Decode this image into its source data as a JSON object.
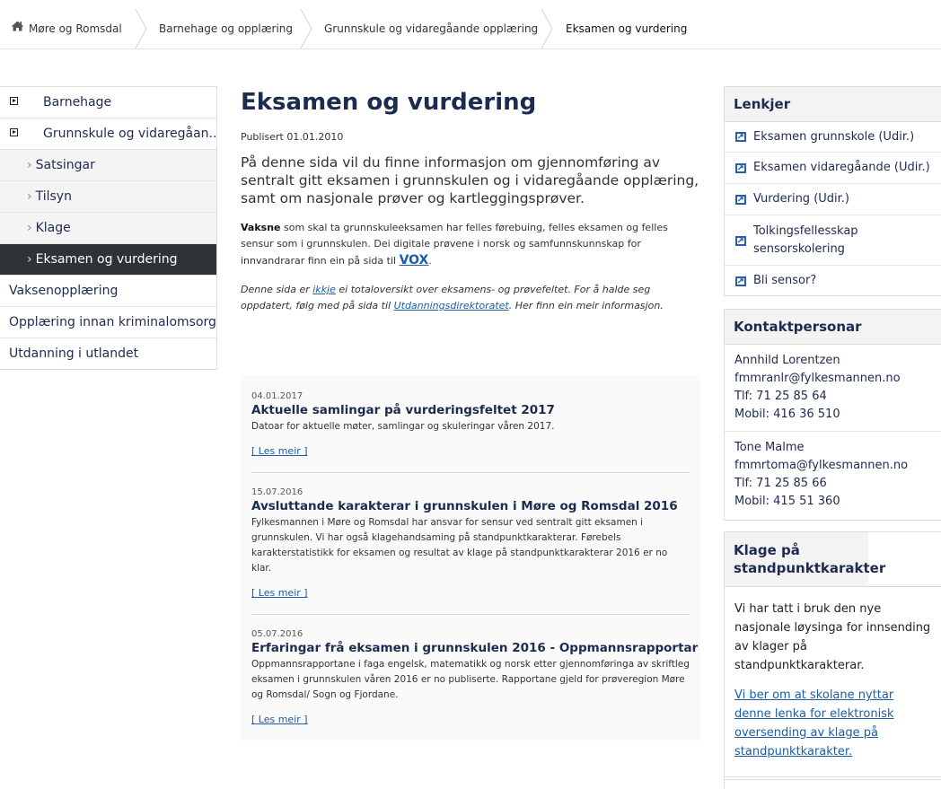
{
  "breadcrumb": {
    "items": [
      "Møre og Romsdal",
      "Barnehage og opplæring",
      "Grunnskule og vidaregåande opplæring",
      "Eksamen og vurdering"
    ]
  },
  "sidebar": {
    "items": [
      {
        "label": "Barnehage"
      },
      {
        "label": "Grunnskule og vidaregåan..."
      },
      {
        "label": "Satsingar"
      },
      {
        "label": "Tilsyn"
      },
      {
        "label": "Klage"
      },
      {
        "label": "Eksamen og vurdering"
      },
      {
        "label": "Vaksenopplæring"
      },
      {
        "label": "Opplæring innan kriminalomsorga"
      },
      {
        "label": "Utdanning i utlandet"
      }
    ]
  },
  "main": {
    "title": "Eksamen og vurdering",
    "published": "Publisert 01.01.2010",
    "ingress": "På denne sida vil du finne informasjon om gjennomføring av sentralt gitt eksamen i grunnskulen og i vidaregåande opplæring, samt om nasjonale prøver og kartleggingsprøver.",
    "para1_bold": "Vaksne",
    "para1_text": " som skal ta grunnskuleeksamen har felles førebuing, felles eksamen og felles sensur som i grunnskulen. Dei digitale prøvene i norsk og samfunnskunnskap for innvandrarar finn ein på sida til ",
    "para1_link": "VOX",
    "para1_end": ".",
    "para2_a": "Denne sida er ",
    "para2_link1": "ikkje",
    "para2_b": " ei totaloversikt over eksamens- og prøvefeltet. For å halde seg oppdatert, følg med på sida til ",
    "para2_link2": "Utdanningsdirektoratet",
    "para2_c": ". Her finn ein meir informasjon."
  },
  "news": [
    {
      "date": "04.01.2017",
      "title": "Aktuelle samlingar på vurderingsfeltet 2017",
      "text": "Datoar for aktuelle møter, samlingar og skuleringar våren 2017.",
      "readmore": "[ Les meir ]"
    },
    {
      "date": "15.07.2016",
      "title": "Avsluttande karakterar i grunnskulen i Møre og Romsdal 2016",
      "text": "Fylkesmannen i Møre og Romsdal har ansvar for sensur ved sentralt gitt eksamen i grunnskulen. Vi har også klagehandsaming på standpunktkarakterar. Førebels karakterstatistikk for eksamen og resultat av klage på standpunktkarakterar 2016 er no klar.",
      "readmore": "[ Les meir ]"
    },
    {
      "date": "05.07.2016",
      "title": "Erfaringar frå eksamen i grunnskulen 2016 - Oppmannsrapportar",
      "text": "Oppmannsrapportane i faga engelsk, matematikk og norsk etter gjennomføringa av skriftleg eksamen i grunnskulen våren 2016 er no publiserte. Rapportane gjeld for prøveregion Møre og Romsdal/ Sogn og Fjordane.",
      "readmore": "[ Les meir ]"
    }
  ],
  "links_box": {
    "title": "Lenkjer",
    "items": [
      "Eksamen grunnskole (Udir.)",
      "Eksamen vidaregåande (Udir.)",
      "Vurdering (Udir.)",
      "Tolkingsfellesskap sensorskolering",
      "Bli sensor?"
    ]
  },
  "contacts_box": {
    "title": "Kontaktpersonar",
    "people": [
      {
        "name": "Annhild Lorentzen",
        "email": "fmmranlr@fylkesmannen.no",
        "phone": "Tlf: 71 25 85 64",
        "mobile": "Mobil: 416 36 510"
      },
      {
        "name": "Tone Malme",
        "email": "fmmrtoma@fylkesmannen.no",
        "phone": "Tlf: 71 25 85 66",
        "mobile": "Mobil: 415 51 360"
      }
    ]
  },
  "klage_box": {
    "title": "Klage på standpunktkarakter",
    "text": "Vi har tatt i bruk den nye nasjonale løysinga for innsending av klager på standpunktkarakterar.",
    "link": "Vi ber om at skolane nyttar denne lenka for elektronisk oversending av klage på standpunktkarakter."
  },
  "icons": {
    "home": "home-icon",
    "expand": "expand-icon",
    "chevron": "chevron-right-icon",
    "link": "external-link-icon"
  }
}
